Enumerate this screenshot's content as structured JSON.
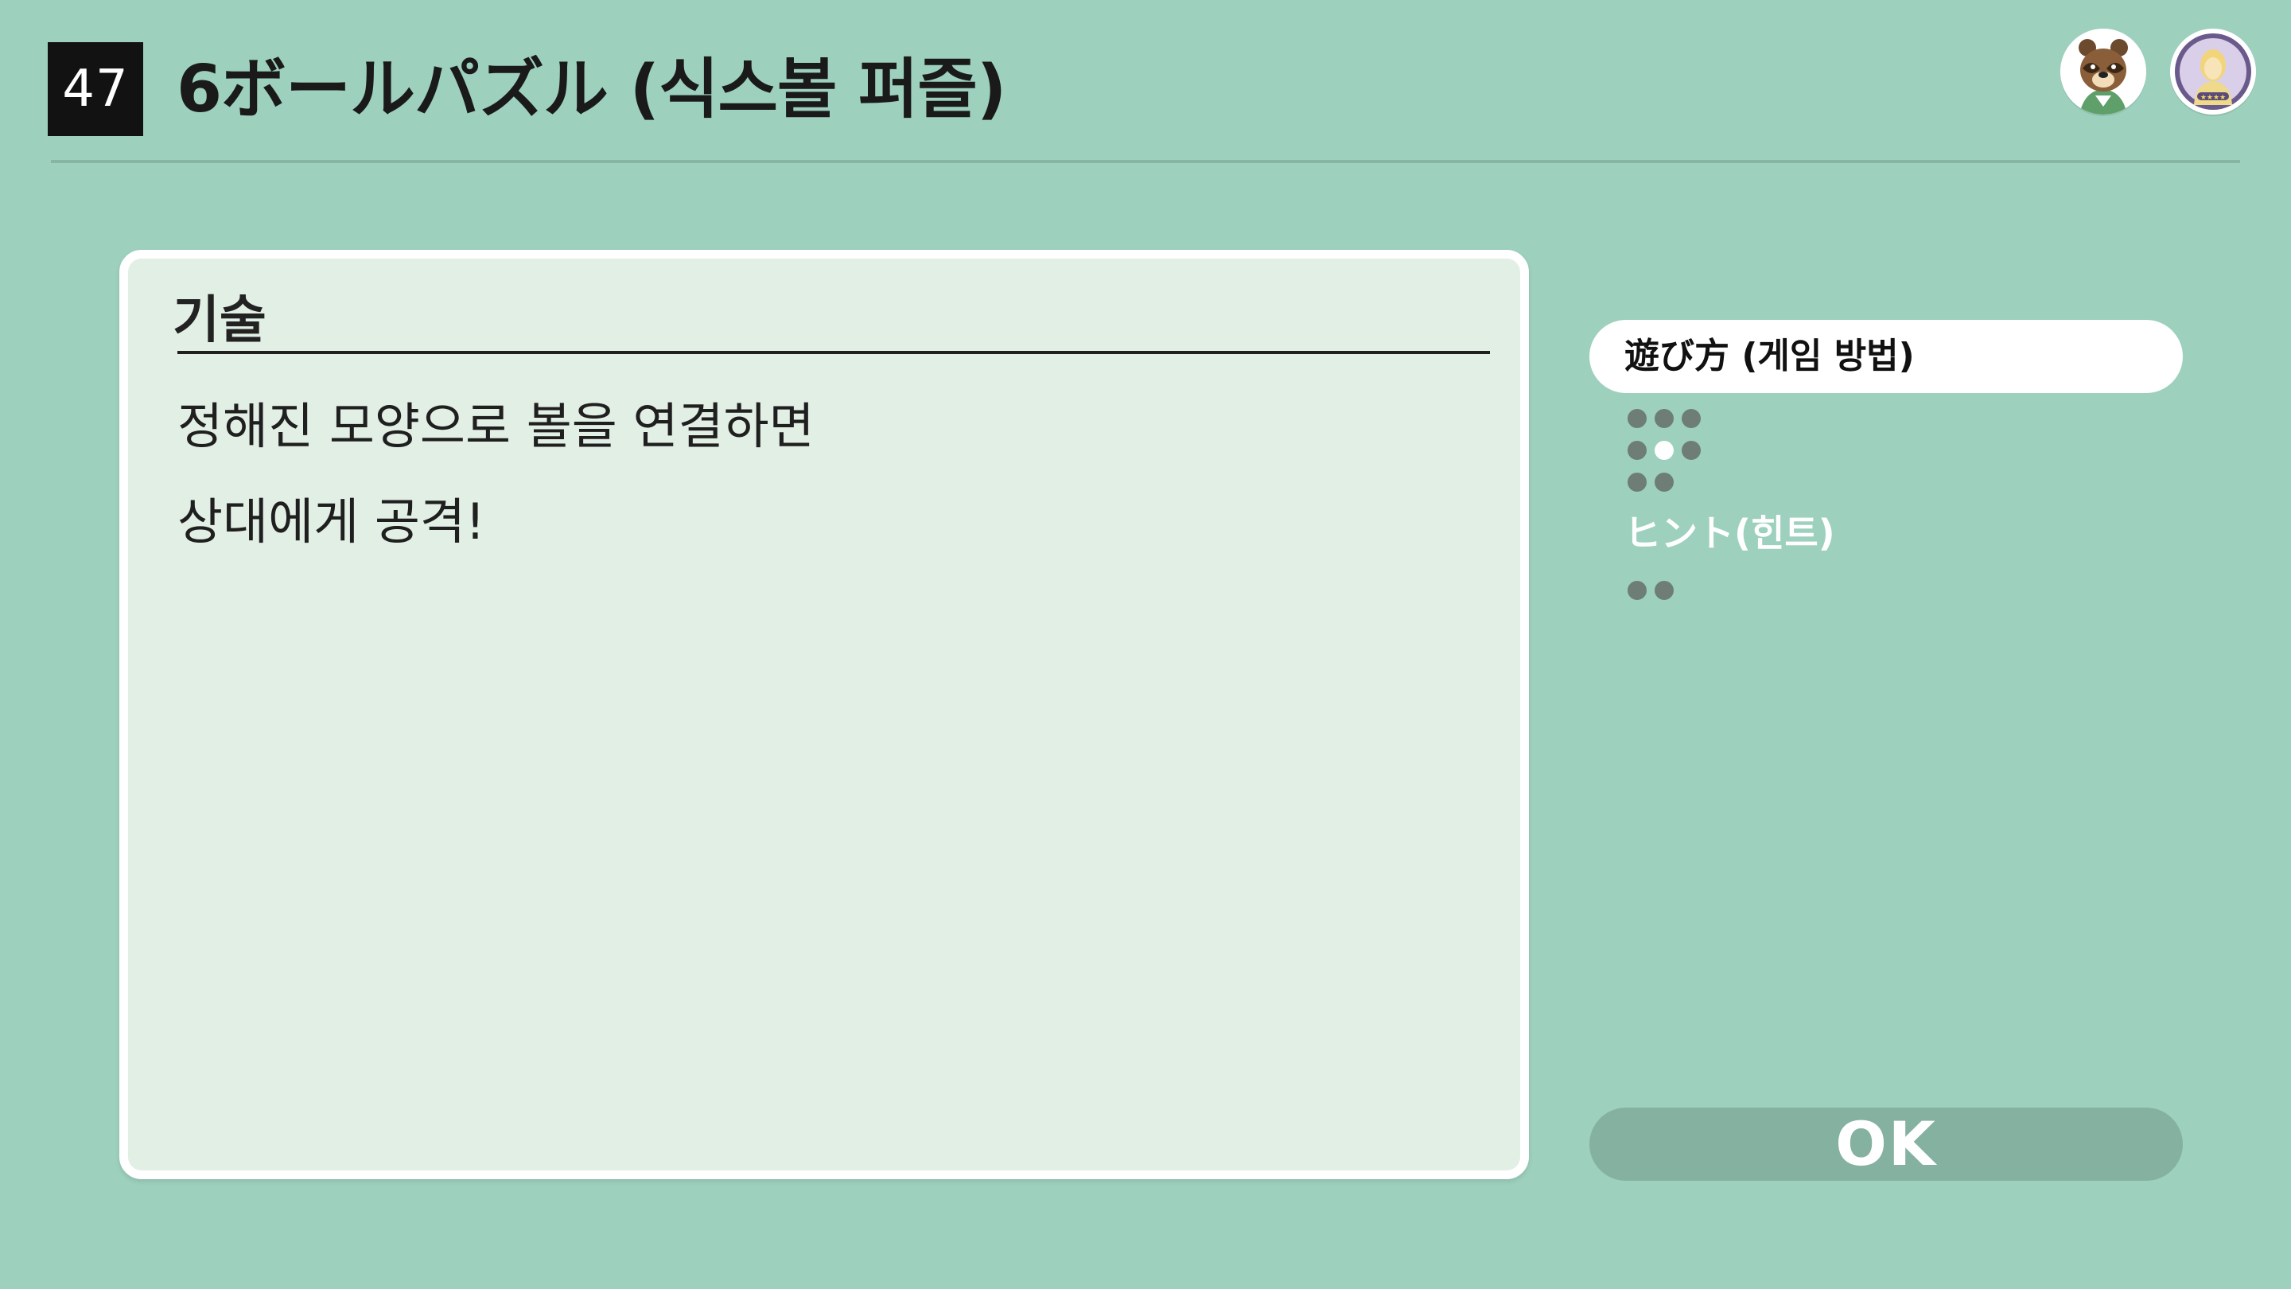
{
  "header": {
    "game_number": "47",
    "title": "6ボールパズル (식스볼 퍼즐)"
  },
  "avatars": [
    {
      "name": "tom-nook-avatar-icon"
    },
    {
      "name": "player-avatar-icon"
    }
  ],
  "description": {
    "heading": "기술",
    "lines": [
      "정해진 모양으로 볼을 연결하면",
      "상대에게 공격!"
    ]
  },
  "tabs": {
    "howto": {
      "label": "遊び方 (게임 방법)",
      "pages_total": 8,
      "current_page": 5
    },
    "hint": {
      "label": "ヒント(힌트)",
      "pages_total": 2
    }
  },
  "ok_button": {
    "label": "OK"
  },
  "colors": {
    "background": "#9dd0bd",
    "card": "#e2efe5",
    "dot_inactive": "#6e7e76",
    "ok_button": "#85b1a1"
  }
}
